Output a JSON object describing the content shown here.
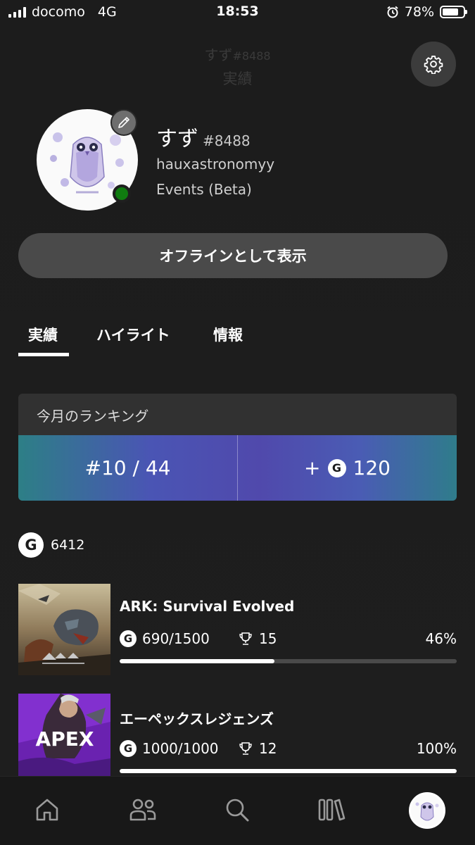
{
  "status_bar": {
    "carrier": "docomo",
    "network": "4G",
    "time": "18:53",
    "battery": "78%",
    "battery_level": 0.78
  },
  "header": {
    "name": "すず",
    "tag": "#8488",
    "subtitle": "実績",
    "settings_icon": "gear-icon"
  },
  "profile": {
    "gamertag": "すず",
    "suffix": "#8488",
    "username": "hauxastronomyy",
    "status": "Events (Beta)",
    "online_color": "#107c10"
  },
  "offline_button": "オフラインとして表示",
  "tabs": [
    {
      "label": "実績",
      "active": true
    },
    {
      "label": "ハイライト",
      "active": false
    },
    {
      "label": "情報",
      "active": false
    }
  ],
  "ranking": {
    "title": "今月のランキング",
    "position": "#10 / 44",
    "gain_prefix": "+",
    "gain_value": "120"
  },
  "gamerscore_total": "6412",
  "g_letter": "G",
  "games": [
    {
      "title": "ARK: Survival Evolved",
      "gamerscore": "690/1500",
      "trophies": "15",
      "percent": "46%",
      "progress": 0.46
    },
    {
      "title": "エーペックスレジェンズ",
      "gamerscore": "1000/1000",
      "trophies": "12",
      "percent": "100%",
      "progress": 1.0
    }
  ],
  "nav": [
    {
      "name": "home-icon"
    },
    {
      "name": "friends-icon"
    },
    {
      "name": "search-icon"
    },
    {
      "name": "library-icon"
    },
    {
      "name": "profile-avatar-icon"
    }
  ],
  "colors": {
    "background": "#1d1d1d",
    "accent_gradient_start": "#2d7f86",
    "accent_gradient_mid": "#5049ac",
    "online": "#107c10"
  }
}
